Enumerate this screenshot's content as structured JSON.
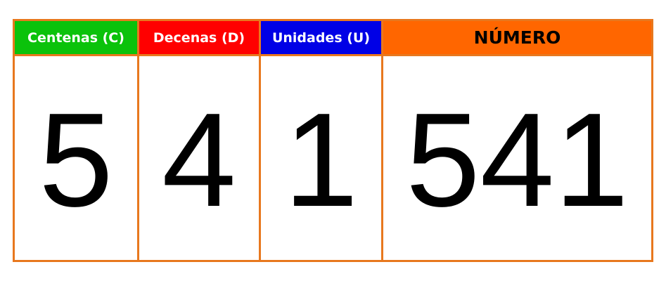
{
  "columns": [
    {
      "header": "Centenas (C)",
      "header_color": "#0bc20b",
      "value": "5"
    },
    {
      "header": "Decenas (D)",
      "header_color": "#ff0000",
      "value": "4"
    },
    {
      "header": "Unidades (U)",
      "header_color": "#0000e6",
      "value": "1"
    }
  ],
  "number": {
    "header": "NÚMERO",
    "header_color": "#ff6600",
    "value": "541"
  },
  "border_color": "#e8781e"
}
